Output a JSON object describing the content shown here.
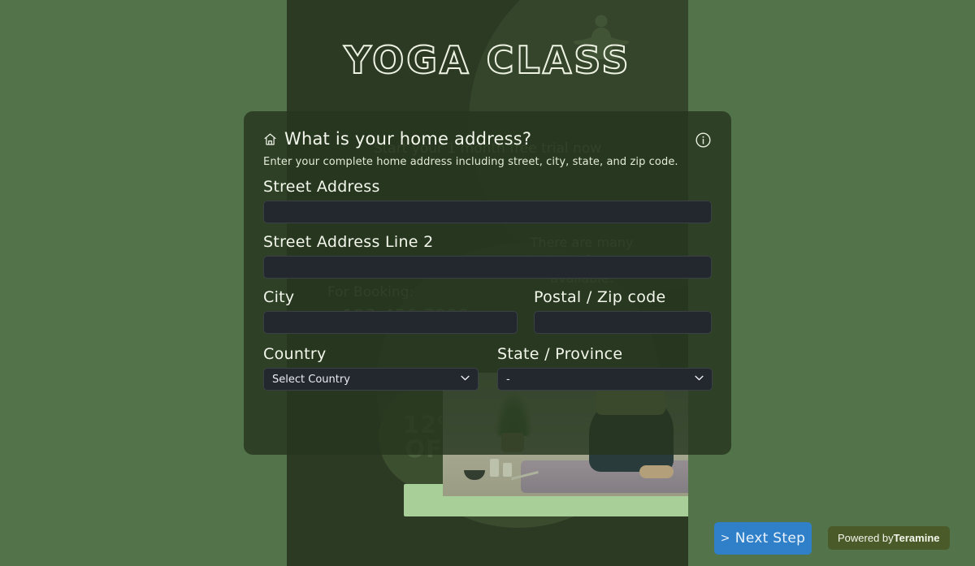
{
  "theme": {
    "page_bg": "#53734b",
    "hero_bg": "#2c3a24",
    "card_bg": "rgba(38,54,30,0.82)",
    "input_bg": "#23272e",
    "accent_blue": "#2f7fc9",
    "badge_olive": "#4a5a28",
    "text_light": "#f2f6eb"
  },
  "hero": {
    "title": "YOGA CLASS",
    "yoga_icon": "lotus-meditation-silhouette-icon",
    "subtitle": "Start your 1 month free trial now",
    "paragraph": "There are many variations of passages available.",
    "booking_label": "For Booking:",
    "booking_phone": "+123-456-7890",
    "offer_percent": "12%",
    "offer_word": "OFF"
  },
  "card": {
    "home_icon": "home-icon",
    "info_icon": "info-circle-icon",
    "question_title": "What is your home address?",
    "question_description": "Enter your complete home address including street, city, state, and zip code.",
    "fields": {
      "street_address": {
        "label": "Street Address",
        "value": "",
        "placeholder": ""
      },
      "street_address_2": {
        "label": "Street Address Line 2",
        "value": "",
        "placeholder": ""
      },
      "city": {
        "label": "City",
        "value": "",
        "placeholder": ""
      },
      "postal_code": {
        "label": "Postal / Zip code",
        "value": "",
        "placeholder": ""
      },
      "country": {
        "label": "Country",
        "selected": "Select Country",
        "chevron_icon": "chevron-down-icon"
      },
      "state": {
        "label": "State / Province",
        "selected": "-",
        "chevron_icon": "chevron-down-icon"
      }
    }
  },
  "footer": {
    "next_step_label": "Next Step",
    "next_step_chevron": ">",
    "powered_prefix": "Powered by",
    "powered_brand": "Teramine"
  }
}
